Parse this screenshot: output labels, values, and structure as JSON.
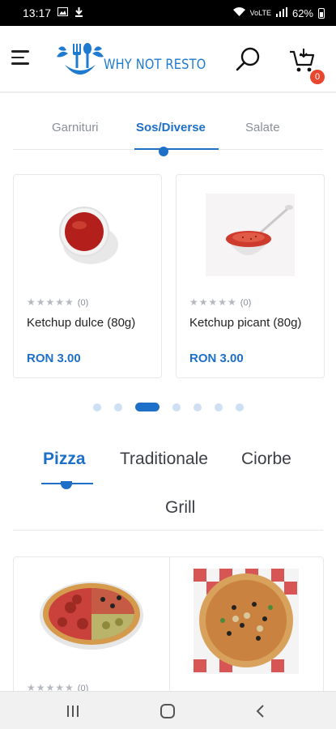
{
  "status_bar": {
    "time": "13:17",
    "battery": "62%",
    "icons": [
      "gallery-icon",
      "download-icon",
      "wifi-icon",
      "volte-icon",
      "signal-icon",
      "battery-icon"
    ]
  },
  "header": {
    "logo_text": "WHY NOT RESTO",
    "cart_count": "0",
    "icons": [
      "hamburger-menu-icon",
      "search-icon",
      "cart-icon"
    ]
  },
  "category_tabs": {
    "items": [
      "Garnituri",
      "Sos/Diverse",
      "Salate"
    ],
    "active": "Sos/Diverse"
  },
  "products": [
    {
      "name": "Ketchup dulce (80g)",
      "price": "RON 3.00",
      "rating_count": "(0)",
      "stars": 0
    },
    {
      "name": "Ketchup picant (80g)",
      "price": "RON 3.00",
      "rating_count": "(0)",
      "stars": 0
    }
  ],
  "carousel": {
    "total": 7,
    "active_index": 2
  },
  "menu_tabs": {
    "items": [
      "Pizza",
      "Traditionale",
      "Ciorbe",
      "Grill"
    ],
    "active": "Pizza"
  },
  "pizza_cards": [
    {
      "rating_count": "(0)",
      "stars": 0
    },
    {
      "rating_count": "",
      "stars": 0
    }
  ],
  "colors": {
    "accent": "#1e6fc8",
    "logo": "#1e7bd0",
    "badge": "#e8462f"
  }
}
